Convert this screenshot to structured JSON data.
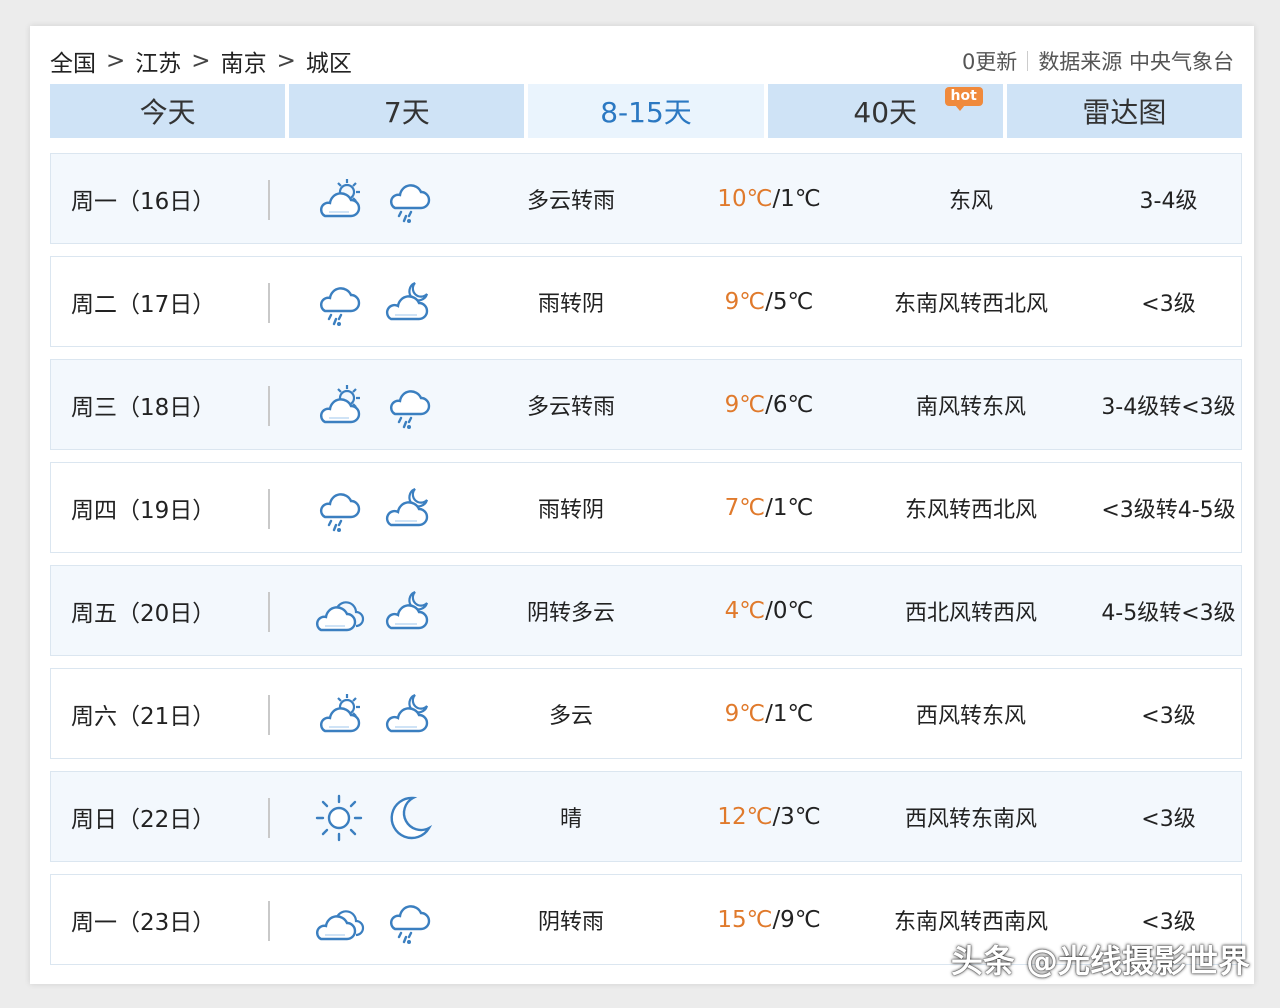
{
  "breadcrumb": [
    "全国",
    "江苏",
    "南京",
    "城区"
  ],
  "breadcrumb_sep": ">",
  "source": {
    "update": "0更新",
    "label": "数据来源 中央气象台"
  },
  "tabs": [
    {
      "label": "今天"
    },
    {
      "label": "7天"
    },
    {
      "label": "8-15天"
    },
    {
      "label": "40天",
      "badge": "hot"
    },
    {
      "label": "雷达图"
    }
  ],
  "rows": [
    {
      "date": "周一（16日）",
      "icons": [
        "cloudy-sun-icon",
        "rain-cloud-icon"
      ],
      "desc": "多云转雨",
      "hi": "10℃",
      "lo": "/1℃",
      "wind": "东风",
      "level": "3-4级"
    },
    {
      "date": "周二（17日）",
      "icons": [
        "rain-cloud-icon",
        "cloudy-moon-icon"
      ],
      "desc": "雨转阴",
      "hi": "9℃",
      "lo": "/5℃",
      "wind": "东南风转西北风",
      "level": "<3级"
    },
    {
      "date": "周三（18日）",
      "icons": [
        "cloudy-sun-icon",
        "rain-cloud-icon"
      ],
      "desc": "多云转雨",
      "hi": "9℃",
      "lo": "/6℃",
      "wind": "南风转东风",
      "level": "3-4级转<3级"
    },
    {
      "date": "周四（19日）",
      "icons": [
        "rain-cloud-icon",
        "cloudy-moon-icon"
      ],
      "desc": "雨转阴",
      "hi": "7℃",
      "lo": "/1℃",
      "wind": "东风转西北风",
      "level": "<3级转4-5级"
    },
    {
      "date": "周五（20日）",
      "icons": [
        "overcast-icon",
        "cloudy-moon-icon"
      ],
      "desc": "阴转多云",
      "hi": "4℃",
      "lo": "/0℃",
      "wind": "西北风转西风",
      "level": "4-5级转<3级"
    },
    {
      "date": "周六（21日）",
      "icons": [
        "cloudy-sun-icon",
        "cloudy-moon-icon"
      ],
      "desc": "多云",
      "hi": "9℃",
      "lo": "/1℃",
      "wind": "西风转东风",
      "level": "<3级"
    },
    {
      "date": "周日（22日）",
      "icons": [
        "sun-icon",
        "moon-icon"
      ],
      "desc": "晴",
      "hi": "12℃",
      "lo": "/3℃",
      "wind": "西风转东南风",
      "level": "<3级"
    },
    {
      "date": "周一（23日）",
      "icons": [
        "overcast-icon",
        "rain-cloud-icon"
      ],
      "desc": "阴转雨",
      "hi": "15℃",
      "lo": "/9℃",
      "wind": "东南风转西南风",
      "level": "<3级"
    }
  ],
  "watermark": "头条 @光线摄影世界",
  "colors": {
    "tab_bg": "#cfe3f6",
    "tab_active_text": "#2b78c2",
    "hi_temp": "#e07a2c",
    "hot_badge": "#f08a3c"
  }
}
